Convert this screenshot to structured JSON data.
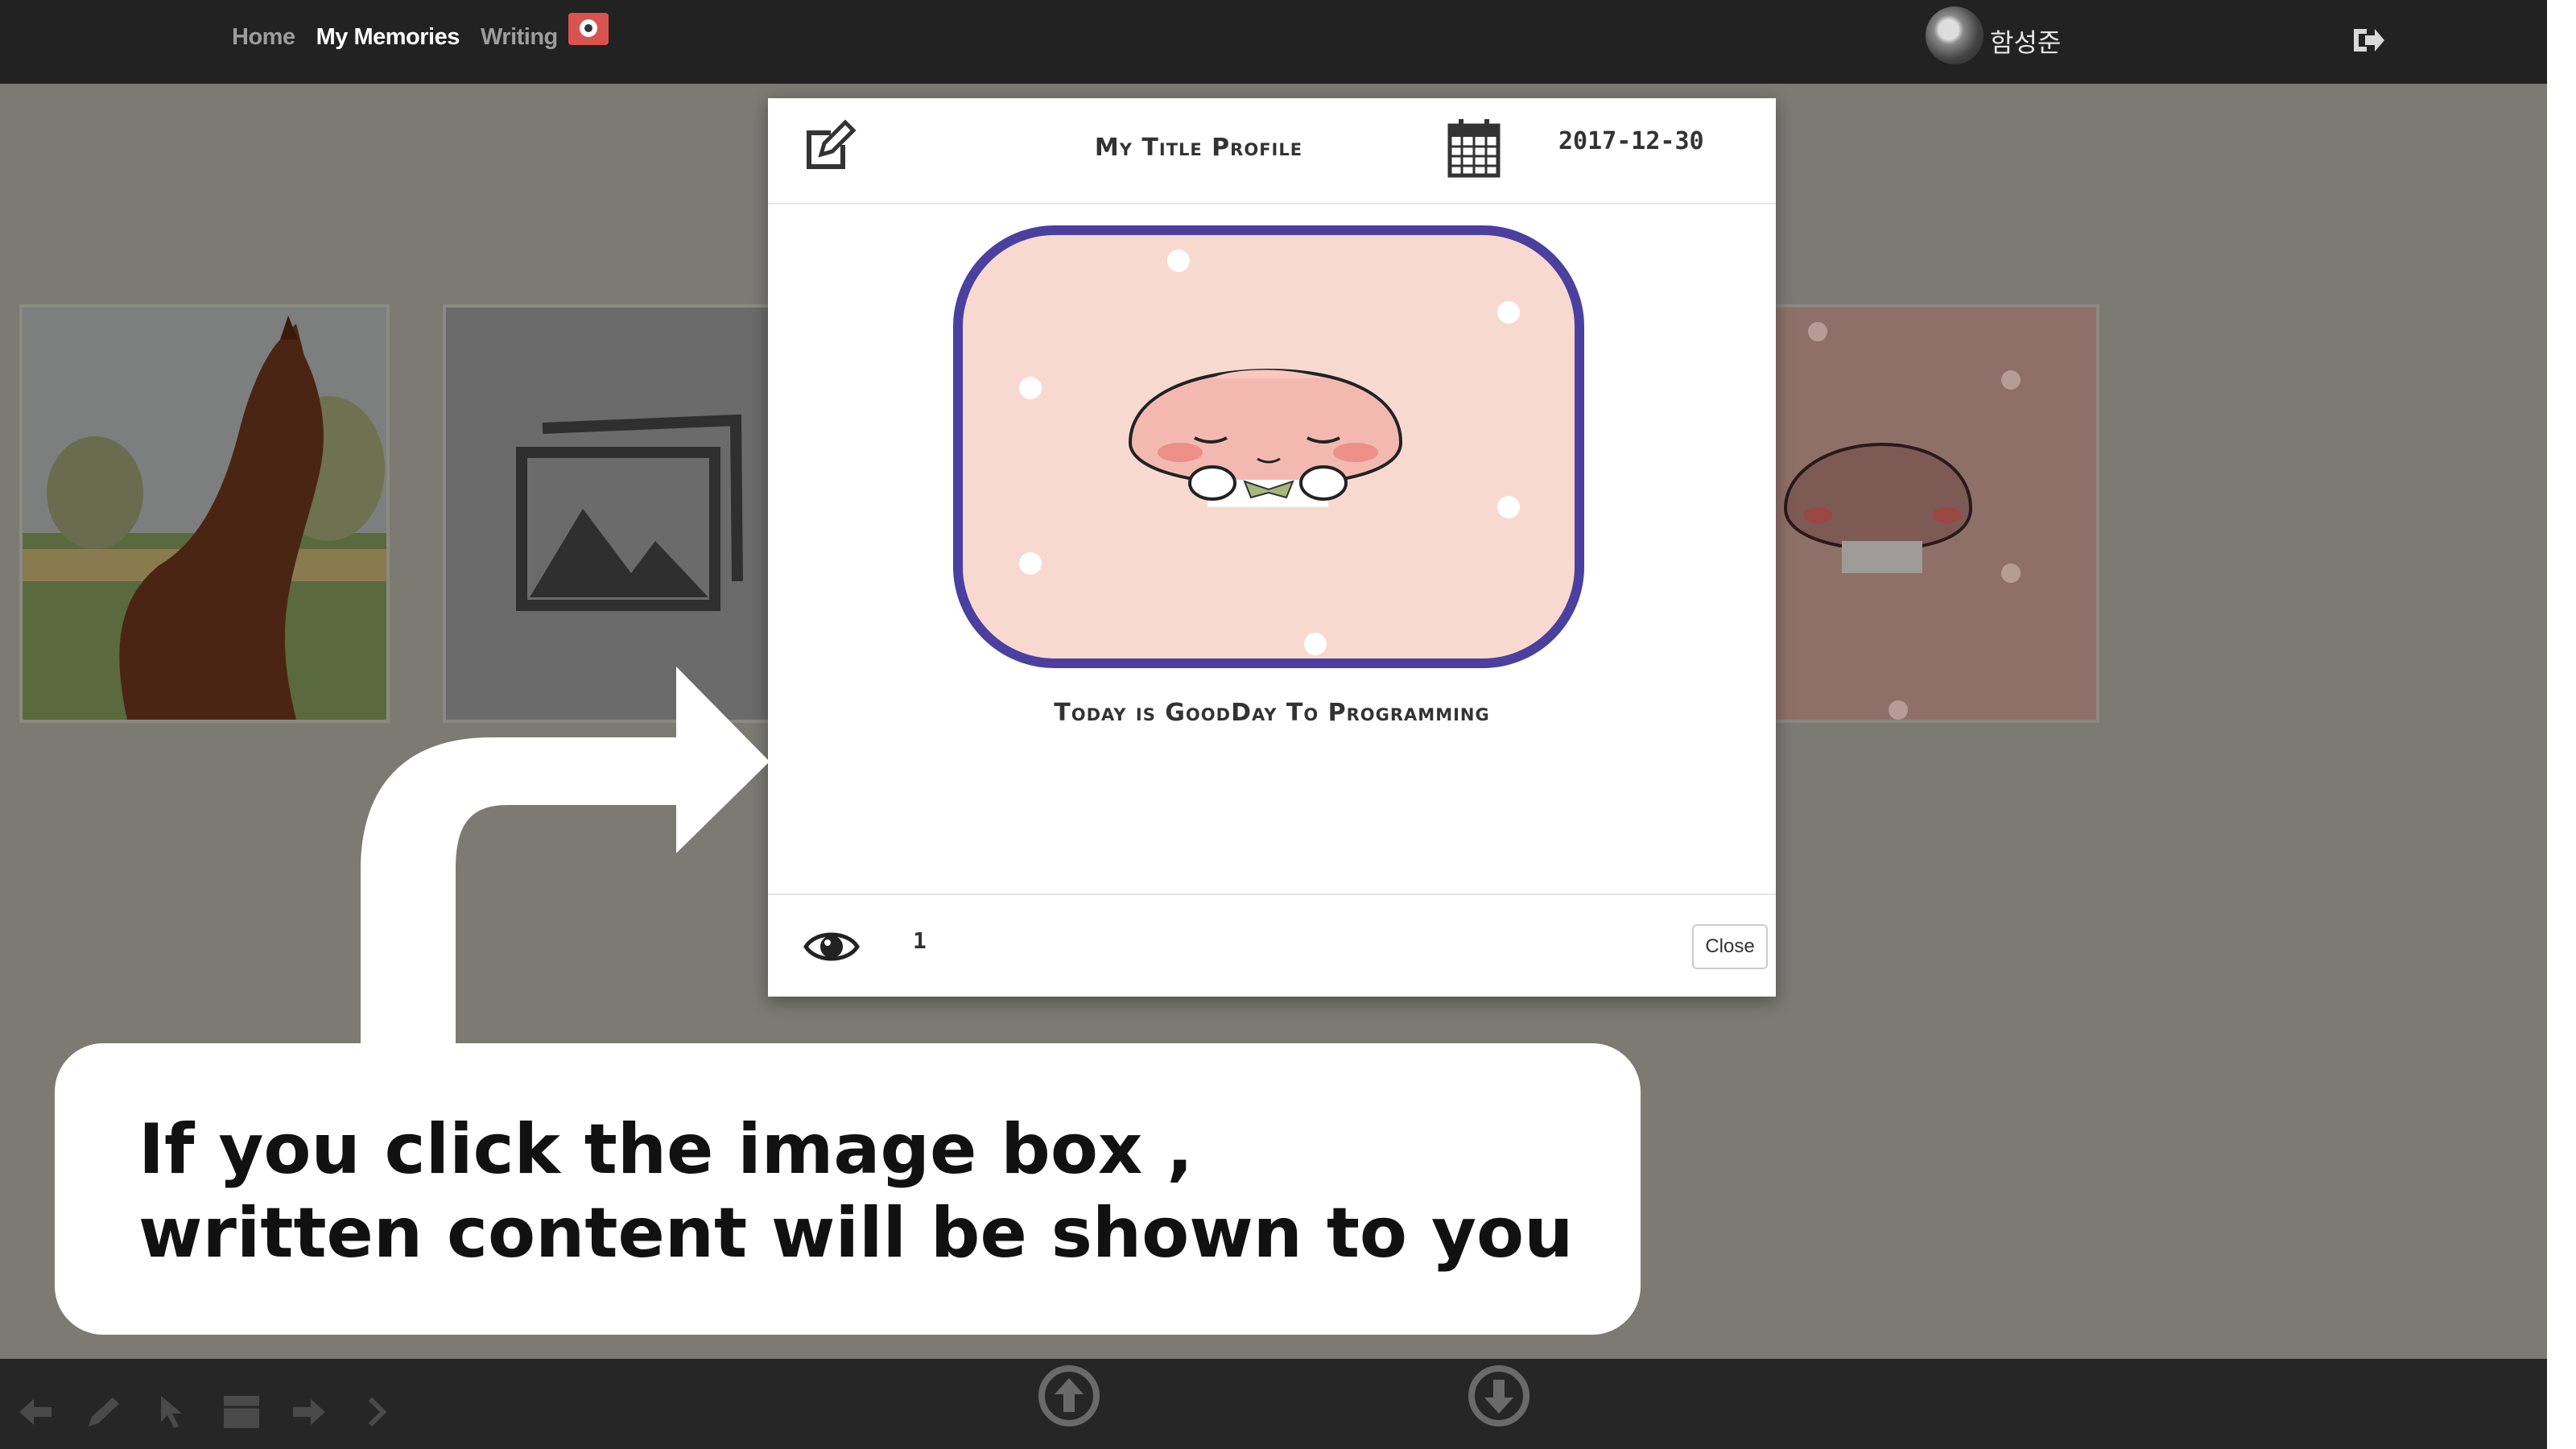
{
  "nav": {
    "links": [
      "Home",
      "My Memories",
      "Writing"
    ],
    "active_link": "My Memories",
    "user_name": "함성준"
  },
  "modal": {
    "title": "My Title Profile",
    "date": "2017-12-30",
    "caption": "Today is GoodDay To Programming",
    "view_count": "1",
    "close_label": "Close"
  },
  "callout": {
    "line1": "If you click the image box ,",
    "line2": "written content will be shown to you"
  },
  "colors": {
    "overlay": "#7b7b74",
    "image_frame": "#4b3fa0",
    "peach_bg": "#f8d9cf",
    "camera": "#d9534f"
  },
  "icons": [
    "camera-icon",
    "logout-icon",
    "edit-icon",
    "calendar-icon",
    "eye-icon",
    "arrow-up-circle-icon",
    "arrow-down-circle-icon"
  ]
}
